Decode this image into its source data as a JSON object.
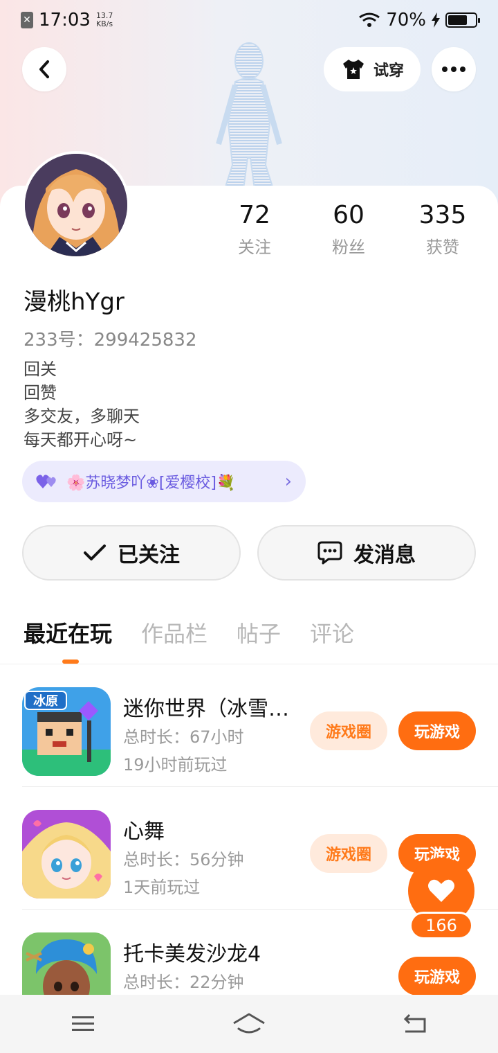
{
  "status_bar": {
    "time": "17:03",
    "speed_value": "13.7",
    "speed_unit": "KB/s",
    "battery": "70%",
    "battery_level": 0.7
  },
  "top_actions": {
    "try_on_label": "试穿"
  },
  "profile": {
    "stats": [
      {
        "value": "72",
        "label": "关注"
      },
      {
        "value": "60",
        "label": "粉丝"
      },
      {
        "value": "335",
        "label": "获赞"
      }
    ],
    "username": "漫桃hYgr",
    "uid_label": "233号：",
    "uid_value": "299425832",
    "bio": [
      "回关",
      "回赞",
      "多交友，多聊天",
      "每天都开心呀~"
    ],
    "tag": "🌸苏晓梦吖❀[爱樱校]💐"
  },
  "actions": {
    "followed_label": "已关注",
    "message_label": "发消息"
  },
  "tabs": [
    "最近在玩",
    "作品栏",
    "帖子",
    "评论"
  ],
  "games": [
    {
      "title": "迷你世界（冰雪…",
      "duration": "总时长：67小时",
      "last_played": "19小时前玩过",
      "circle_label": "游戏圈",
      "play_label": "玩游戏",
      "icon_text": "冰原"
    },
    {
      "title": "心舞",
      "duration": "总时长：56分钟",
      "last_played": "1天前玩过",
      "circle_label": "游戏圈",
      "play_label": "玩游戏"
    },
    {
      "title": "托卡美发沙龙4",
      "duration": "总时长：22分钟",
      "play_label": "玩游戏"
    }
  ],
  "like_count": "166",
  "colors": {
    "accent": "#ff6d11",
    "accent_light": "#ffeadc",
    "tag_bg": "#ecebfd",
    "tag_text": "#6a5be0"
  }
}
